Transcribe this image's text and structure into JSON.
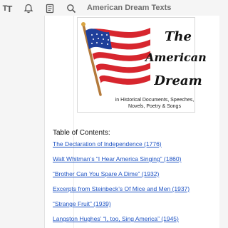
{
  "toolbar": {
    "title": "American Dream Texts",
    "icons": [
      "text-size-icon",
      "bell-icon",
      "document-icon",
      "search-icon"
    ]
  },
  "hero": {
    "title_lines": [
      "The",
      "American",
      "Dream"
    ],
    "subtitle_lines": [
      "in Historical Documents, Speeches,",
      "Novels, Poetry & Songs"
    ],
    "flag_colors": {
      "red": "#d7262e",
      "blue": "#1f3f9a",
      "white": "#ffffff",
      "pole": "#b47a3b"
    }
  },
  "toc": {
    "heading": "Table of Contents:",
    "links": [
      "The Declaration of Independence (1776)",
      "Walt Whitman’s “I Hear America Singing” (1860)",
      "“Brother Can You Spare A Dime” (1932)",
      "Excerpts from Steinbeck’s Of Mice and Men (1937)",
      "“Strange Fruit” (1939)",
      "Langston Hughes’ “I, too, Sing America” (1945)"
    ]
  },
  "colors": {
    "link": "#1f54c4",
    "toolbar_title": "#6e6e6e"
  }
}
